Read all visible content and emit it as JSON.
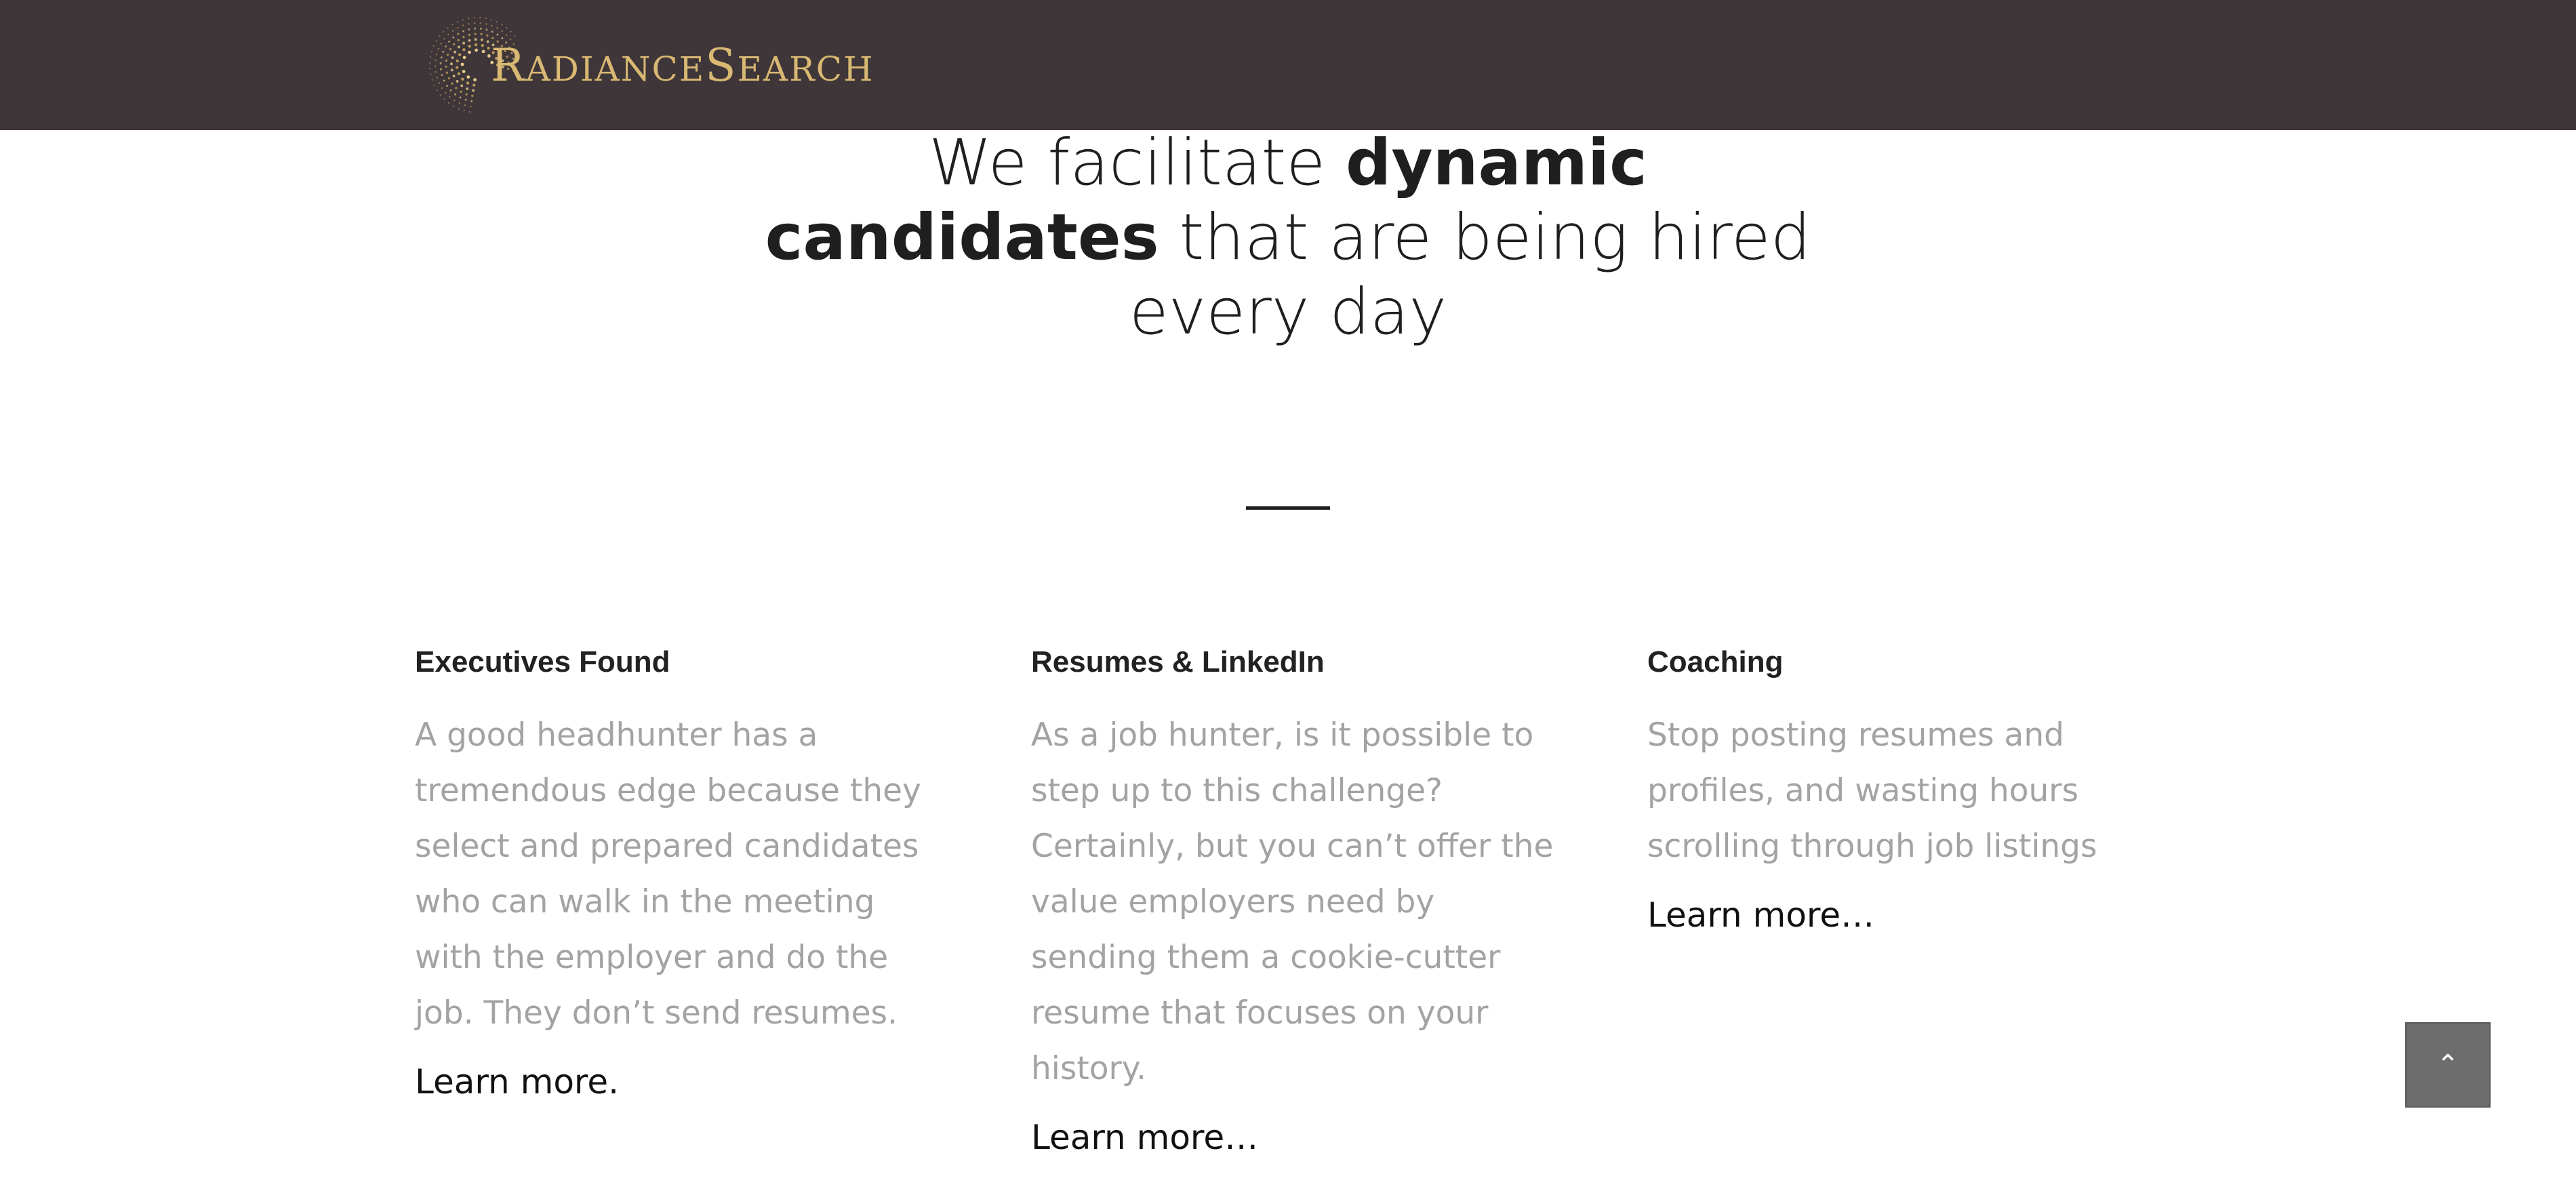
{
  "header": {
    "logo": {
      "letter_r": "R",
      "part1": "ADIANCE",
      "letter_s": "S",
      "part2": "EARCH"
    }
  },
  "headline": {
    "part1": "We facilitate ",
    "bold1": "dynamic candidates",
    "part2": " that are being hired every day"
  },
  "columns": [
    {
      "title": "Executives Found",
      "body": "A good headhunter has a tremendous edge because they select and prepared candidates who can walk in the meeting with the employer and do the job.  They don’t send resumes.",
      "link": "Learn more."
    },
    {
      "title": "Resumes & LinkedIn",
      "body": "As a job hunter, is it possible to step up to this challenge? Certainly, but you can’t offer the value employers need by sending them a cookie-cutter resume that focuses on your history.",
      "link": "Learn more…"
    },
    {
      "title": "Coaching",
      "body": "Stop posting resumes and profiles, and wasting hours scrolling through job listings",
      "link": "Learn more…"
    }
  ],
  "scroll_top": {
    "icon": "chevron-up-icon",
    "glyph": "⌃"
  },
  "colors": {
    "header_bg": "#3e3638",
    "logo_gold": "#d9b873",
    "body_text": "#a3a3a3"
  }
}
